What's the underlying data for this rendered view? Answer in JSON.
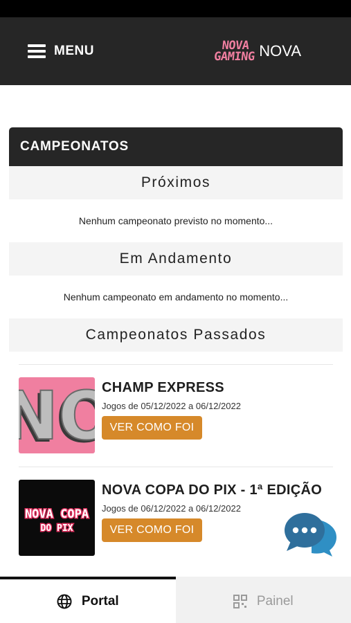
{
  "header": {
    "menu_label": "MENU",
    "logo_line1": "NOVA",
    "logo_line2": "GAMING",
    "brand_name": "NOVA"
  },
  "card": {
    "title": "CAMPEONATOS",
    "sections": {
      "proximos": {
        "title": "Próximos",
        "empty_text": "Nenhum campeonato previsto no momento..."
      },
      "andamento": {
        "title": "Em Andamento",
        "empty_text": "Nenhum campeonato em andamento no momento..."
      },
      "passados": {
        "title": "Campeonatos Passados"
      }
    },
    "past": [
      {
        "title": "CHAMP EXPRESS",
        "dates": "Jogos de 05/12/2022 a 06/12/2022",
        "button": "VER COMO FOI",
        "thumb_text": "NO"
      },
      {
        "title": "NOVA COPA DO PIX - 1ª EDIÇÃO",
        "dates": "Jogos de 06/12/2022 a 06/12/2022",
        "button": "VER COMO FOI",
        "thumb_line1": "NOVA COPA",
        "thumb_line2": "DO PIX"
      }
    ]
  },
  "tabs": {
    "portal": "Portal",
    "painel": "Painel"
  },
  "colors": {
    "dark": "#262626",
    "accent": "#d6892a",
    "pink": "#f07fa0",
    "chat_blue": "#2f6f9c"
  },
  "icons": {
    "menu": "hamburger-icon",
    "chat": "chat-bubbles-icon",
    "portal": "globe-icon",
    "painel": "qr-grid-icon"
  }
}
